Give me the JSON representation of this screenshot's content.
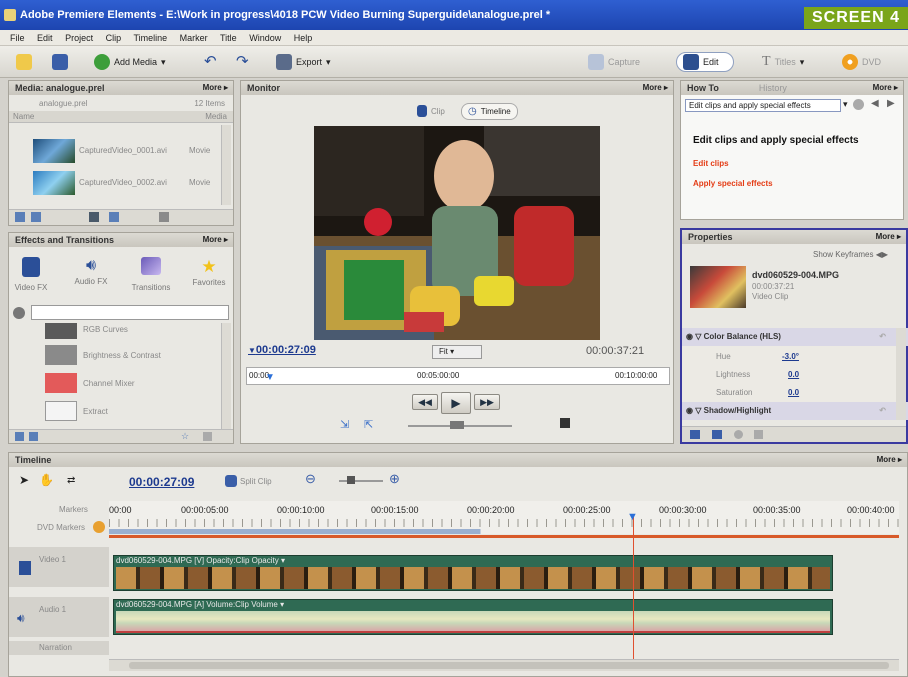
{
  "window": {
    "title": "Adobe Premiere Elements - E:\\Work in progress\\4018 PCW Video Burning Superguide\\analogue.prel *"
  },
  "badge": "SCREEN 4",
  "menu": [
    "File",
    "Edit",
    "Project",
    "Clip",
    "Timeline",
    "Marker",
    "Title",
    "Window",
    "Help"
  ],
  "toolbar": {
    "add_media": "Add Media",
    "export": "Export",
    "capture": "Capture",
    "edit": "Edit",
    "titles": "Titles",
    "dvd": "DVD"
  },
  "media_panel": {
    "title": "Media: analogue.prel",
    "more": "More",
    "project": "analogue.prel",
    "items_count": "12 Items",
    "col_name": "Name",
    "col_media": "Media",
    "items": [
      {
        "name": "CapturedVideo_0001.avi",
        "type": "Movie"
      },
      {
        "name": "CapturedVideo_0002.avi",
        "type": "Movie"
      }
    ]
  },
  "effects_panel": {
    "title": "Effects and Transitions",
    "more": "More",
    "categories": [
      "Video FX",
      "Audio FX",
      "Transitions",
      "Favorites"
    ],
    "search_placeholder": "",
    "list": [
      "RGB Curves",
      "Brightness & Contrast",
      "Channel Mixer",
      "Extract"
    ]
  },
  "monitor": {
    "title": "Monitor",
    "more": "More",
    "tab_clip": "Clip",
    "tab_timeline": "Timeline",
    "current_time": "00:00:27:09",
    "fit": "Fit",
    "duration": "00:00:37:21",
    "ruler": [
      "00:00",
      "00:05:00:00",
      "00:10:00:00"
    ]
  },
  "howto": {
    "title": "How To",
    "tab_history": "History",
    "more": "More",
    "dropdown": "Edit clips and apply special effects",
    "heading": "Edit clips and apply special effects",
    "links": [
      "Edit clips",
      "Apply special effects"
    ]
  },
  "properties": {
    "title": "Properties",
    "more": "More",
    "show_keyframes": "Show Keyframes",
    "clip_name": "dvd060529-004.MPG",
    "clip_time": "00:00:37:21",
    "clip_type": "Video Clip",
    "effect1": "Color Balance (HLS)",
    "params": [
      {
        "label": "Hue",
        "value": "-3.0°"
      },
      {
        "label": "Lightness",
        "value": "0.0"
      },
      {
        "label": "Saturation",
        "value": "0.0"
      }
    ],
    "effect2": "Shadow/Highlight"
  },
  "timeline": {
    "title": "Timeline",
    "more": "More",
    "current_time": "00:00:27:09",
    "split_clip": "Split Clip",
    "ruler": [
      "00:00",
      "00:00:05:00",
      "00:00:10:00",
      "00:00:15:00",
      "00:00:20:00",
      "00:00:25:00",
      "00:00:30:00",
      "00:00:35:00",
      "00:00:40:00"
    ],
    "row_labels": [
      "Markers",
      "DVD Markers"
    ],
    "video_track": "Video 1",
    "audio_track": "Audio 1",
    "video3_track": "Narration",
    "video_clip": "dvd060529-004.MPG [V]  Opacity:Clip Opacity ▾",
    "audio_clip": "dvd060529-004.MPG [A]  Volume:Clip Volume ▾"
  }
}
